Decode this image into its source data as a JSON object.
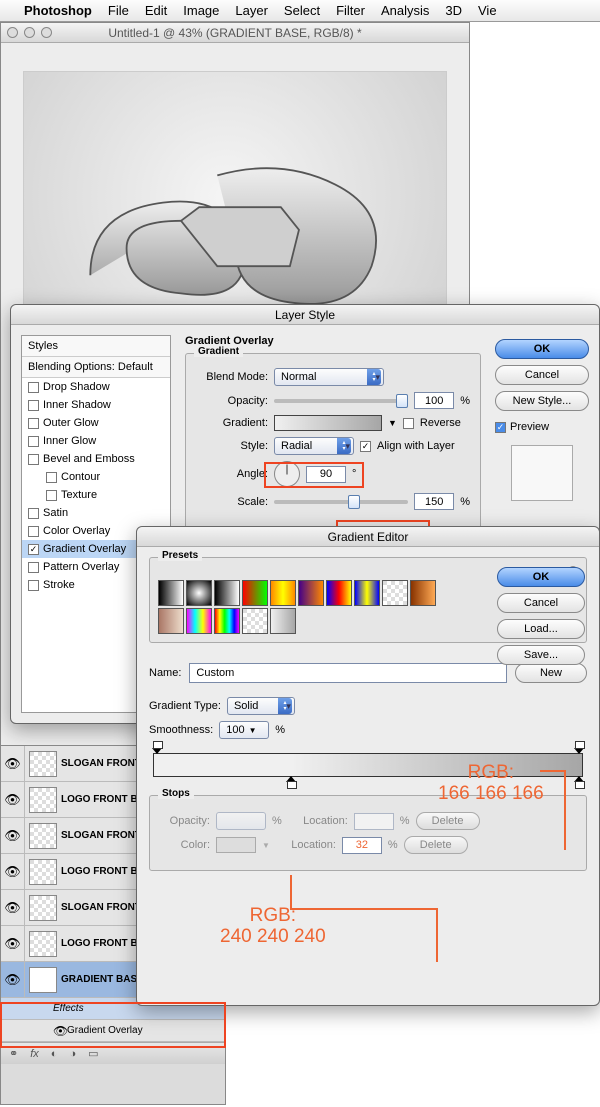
{
  "menubar": {
    "app": "Photoshop",
    "items": [
      "File",
      "Edit",
      "Image",
      "Layer",
      "Select",
      "Filter",
      "Analysis",
      "3D",
      "Vie"
    ]
  },
  "document": {
    "title": "Untitled-1 @ 43% (GRADIENT BASE, RGB/8) *"
  },
  "layerStyle": {
    "title": "Layer Style",
    "leftHeader": "Styles",
    "blending": "Blending Options: Default",
    "items": [
      {
        "label": "Drop Shadow",
        "checked": false
      },
      {
        "label": "Inner Shadow",
        "checked": false
      },
      {
        "label": "Outer Glow",
        "checked": false
      },
      {
        "label": "Inner Glow",
        "checked": false
      },
      {
        "label": "Bevel and Emboss",
        "checked": false
      },
      {
        "label": "Contour",
        "checked": false,
        "indent": true
      },
      {
        "label": "Texture",
        "checked": false,
        "indent": true
      },
      {
        "label": "Satin",
        "checked": false
      },
      {
        "label": "Color Overlay",
        "checked": false
      },
      {
        "label": "Gradient Overlay",
        "checked": true,
        "selected": true
      },
      {
        "label": "Pattern Overlay",
        "checked": false
      },
      {
        "label": "Stroke",
        "checked": false
      }
    ],
    "section": "Gradient Overlay",
    "group": "Gradient",
    "blendMode": {
      "label": "Blend Mode:",
      "value": "Normal"
    },
    "opacity": {
      "label": "Opacity:",
      "value": "100",
      "unit": "%"
    },
    "gradient": {
      "label": "Gradient:",
      "reverse": "Reverse"
    },
    "style": {
      "label": "Style:",
      "value": "Radial",
      "align": "Align with Layer"
    },
    "angle": {
      "label": "Angle:",
      "value": "90",
      "deg": "°"
    },
    "scale": {
      "label": "Scale:",
      "value": "150",
      "unit": "%"
    },
    "buttons": {
      "ok": "OK",
      "cancel": "Cancel",
      "newStyle": "New Style...",
      "preview": "Preview"
    }
  },
  "gradientEditor": {
    "title": "Gradient Editor",
    "presets": "Presets",
    "nameLabel": "Name:",
    "name": "Custom",
    "newBtn": "New",
    "gradType": {
      "label": "Gradient Type:",
      "value": "Solid"
    },
    "smoothness": {
      "label": "Smoothness:",
      "value": "100",
      "unit": "%"
    },
    "stops": {
      "title": "Stops",
      "opacityLabel": "Opacity:",
      "colorLabel": "Color:",
      "locationLabel": "Location:",
      "locationValue": "32",
      "unit": "%",
      "delete": "Delete"
    },
    "buttons": {
      "ok": "OK",
      "cancel": "Cancel",
      "load": "Load...",
      "save": "Save..."
    },
    "presetGradients": [
      "linear-gradient(90deg,#000,#fff)",
      "radial-gradient(#fff,#000)",
      "linear-gradient(90deg,#000,#fff)",
      "linear-gradient(90deg,#f00,#0f0)",
      "linear-gradient(90deg,#f80,#ff0,#f80)",
      "linear-gradient(90deg,#408,#f80)",
      "linear-gradient(90deg,#00f,#f00,#ff0)",
      "linear-gradient(90deg,#00f,#ff0,#00f)",
      "repeating-conic-gradient(#fff 0 25%,#ddd 0 50%) 0 0/8px 8px",
      "linear-gradient(90deg,#830,#fa5)",
      "linear-gradient(90deg,#a76,#edc)",
      "linear-gradient(90deg,#f0f,#0ff,#ff0,#f0f)",
      "linear-gradient(90deg,#f00,#ff0,#0f0,#0ff,#00f,#f0f)",
      "repeating-conic-gradient(#fff 0 25%,#ddd 0 50%) 0 0/8px 8px",
      "linear-gradient(90deg,#f0f0f0,#a6a6a6)"
    ]
  },
  "annotations": {
    "right": "RGB:\n166 166 166",
    "left": "RGB:\n240 240 240"
  },
  "layers": {
    "items": [
      {
        "name": "SLOGAN FRONT A",
        "tr": true
      },
      {
        "name": "LOGO FRONT B",
        "tr": true
      },
      {
        "name": "SLOGAN FRONT A",
        "tr": true
      },
      {
        "name": "LOGO FRONT B",
        "tr": true
      },
      {
        "name": "SLOGAN FRONT A",
        "tr": true
      },
      {
        "name": "LOGO FRONT B",
        "tr": true
      },
      {
        "name": "GRADIENT BASE",
        "tr": false,
        "selected": true,
        "fx": true
      }
    ],
    "effect": "Gradient Overlay",
    "effectsLabel": "Effects",
    "fx": "fx"
  }
}
